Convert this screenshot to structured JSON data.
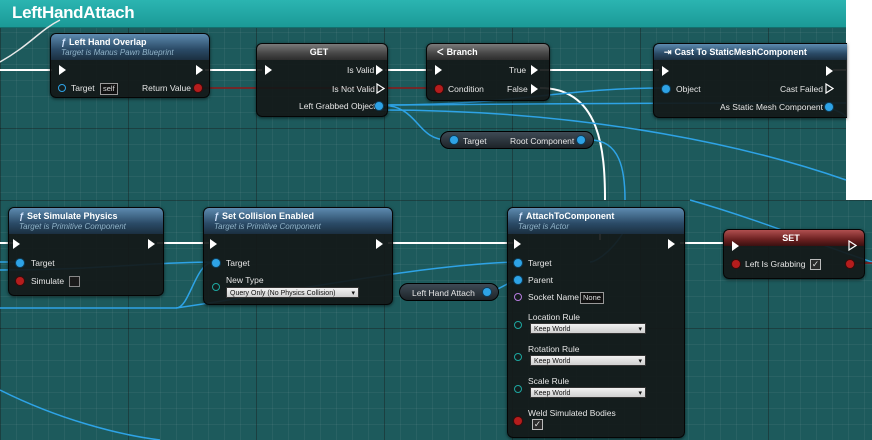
{
  "graph": {
    "title": "LeftHandAttach"
  },
  "nodes": {
    "left_hand_overlap": {
      "title": "Left Hand Overlap",
      "subtitle": "Target is Manus Pawn Blueprint",
      "target_label": "Target",
      "target_value": "self",
      "return_label": "Return Value"
    },
    "get": {
      "title": "GET",
      "is_valid": "Is Valid",
      "is_not_valid": "Is Not Valid",
      "left_grabbed_object": "Left Grabbed Object"
    },
    "branch": {
      "title": "Branch",
      "true_label": "True",
      "false_label": "False",
      "condition_label": "Condition"
    },
    "cast": {
      "title": "Cast To StaticMeshComponent",
      "object_label": "Object",
      "cast_failed": "Cast Failed",
      "as_static_mesh": "As Static Mesh Component"
    },
    "root_component": {
      "target_label": "Target",
      "output_label": "Root Component"
    },
    "set_simulate_physics": {
      "title": "Set Simulate Physics",
      "subtitle": "Target is Primitive Component",
      "target_label": "Target",
      "simulate_label": "Simulate",
      "simulate_checked": false
    },
    "set_collision_enabled": {
      "title": "Set Collision Enabled",
      "subtitle": "Target is Primitive Component",
      "target_label": "Target",
      "new_type_label": "New Type",
      "new_type_value": "Query Only (No Physics Collision)"
    },
    "left_hand_attach": {
      "label": "Left Hand Attach"
    },
    "attach_to_component": {
      "title": "AttachToComponent",
      "subtitle": "Target is Actor",
      "target_label": "Target",
      "parent_label": "Parent",
      "socket_label": "Socket Name",
      "socket_value": "None",
      "location_rule_label": "Location Rule",
      "location_rule_value": "Keep World",
      "rotation_rule_label": "Rotation Rule",
      "rotation_rule_value": "Keep World",
      "scale_rule_label": "Scale Rule",
      "scale_rule_value": "Keep World",
      "weld_label": "Weld Simulated Bodies",
      "weld_checked": true
    },
    "set_var": {
      "title": "SET",
      "var_label": "Left Is Grabbing",
      "var_checked": true
    }
  },
  "colors": {
    "object_pin": "#2ea3e6",
    "bool_pin": "#b51d1d",
    "exec_wire": "#ffffff",
    "function_header": "#2a4a66",
    "grid": "#1d5a5c",
    "title_bar": "#1fa8a4"
  },
  "icons": {
    "function": "function-icon",
    "branch": "branch-icon",
    "cast": "cast-icon"
  }
}
